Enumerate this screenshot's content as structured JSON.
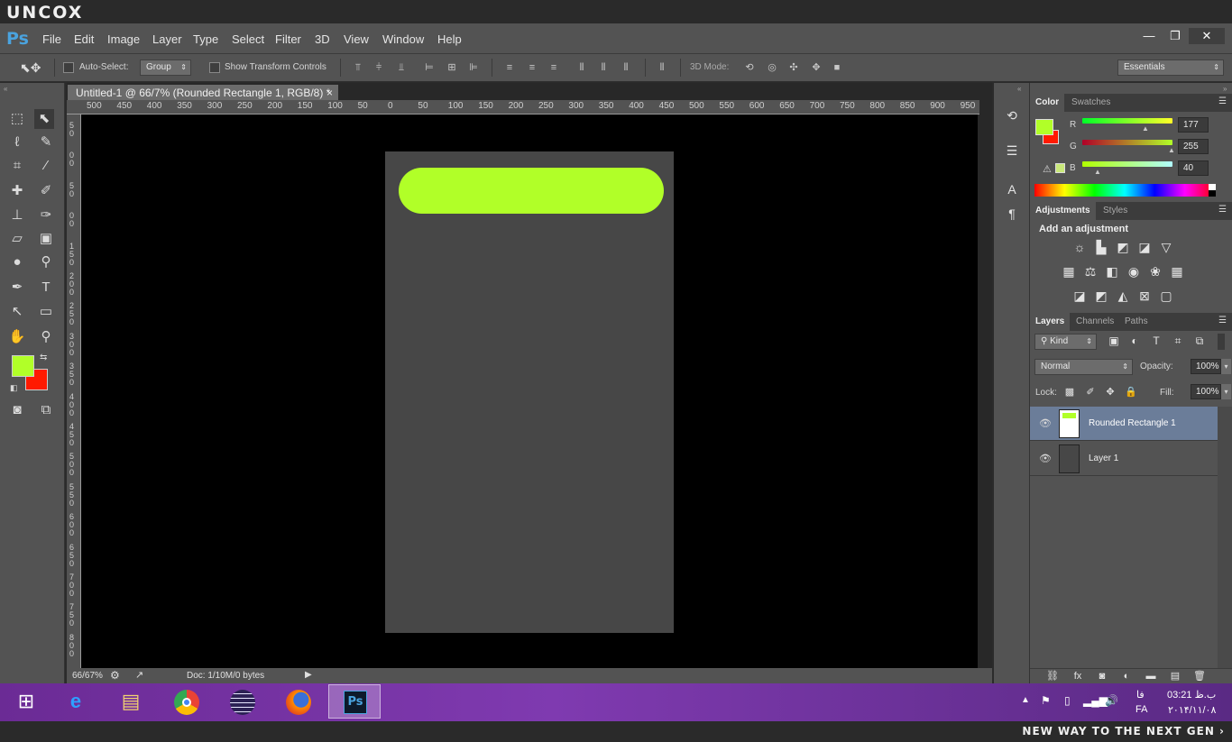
{
  "watermark_top": "UNCOX",
  "watermark_bottom": "NEW WAY TO THE NEXT GEN ›",
  "app": {
    "logo": "Ps",
    "menu": [
      "File",
      "Edit",
      "Image",
      "Layer",
      "Type",
      "Select",
      "Filter",
      "3D",
      "View",
      "Window",
      "Help"
    ]
  },
  "window_controls": {
    "minimize": "—",
    "restore": "❐",
    "close": "✕"
  },
  "options": {
    "auto_select_label": "Auto-Select:",
    "auto_select_value": "Group",
    "transform_label": "Show Transform Controls",
    "mode3d_label": "3D Mode:",
    "workspace": "Essentials"
  },
  "document": {
    "tab_title": "Untitled-1 @ 66/7% (Rounded Rectangle 1, RGB/8) *",
    "tab_close": "×",
    "zoom": "66/67%",
    "doc_info": "Doc: 1/10M/0 bytes"
  },
  "ruler": {
    "h": [
      "500",
      "450",
      "400",
      "350",
      "300",
      "250",
      "200",
      "150",
      "100",
      "50",
      "0",
      "50",
      "100",
      "150",
      "200",
      "250",
      "300",
      "350",
      "400",
      "450",
      "500",
      "550",
      "600",
      "650",
      "700",
      "750",
      "800",
      "850",
      "900",
      "950"
    ],
    "v": [
      "50",
      "00",
      "50",
      "00",
      "150",
      "200",
      "250",
      "300",
      "350",
      "400",
      "450",
      "500",
      "550",
      "600",
      "650",
      "700",
      "750",
      "800"
    ]
  },
  "colors": {
    "foreground": "#b1ff28",
    "background": "#ff1a00",
    "canvas": "#474747",
    "shape": "#b1ff28"
  },
  "color_panel": {
    "tabs": [
      "Color",
      "Swatches"
    ],
    "r_label": "R",
    "g_label": "G",
    "b_label": "B",
    "r": "177",
    "g": "255",
    "b": "40"
  },
  "adjustments": {
    "tabs": [
      "Adjustments",
      "Styles"
    ],
    "heading": "Add an adjustment",
    "icons": [
      "brightness-icon",
      "levels-icon",
      "curves-icon",
      "exposure-icon",
      "vibrance-icon",
      "hue-saturation-icon",
      "color-balance-icon",
      "black-white-icon",
      "photo-filter-icon",
      "channel-mixer-icon",
      "color-lookup-icon",
      "invert-icon",
      "posterize-icon",
      "threshold-icon",
      "gradient-map-icon",
      "selective-color-icon"
    ]
  },
  "layers": {
    "tabs": [
      "Layers",
      "Channels",
      "Paths"
    ],
    "filter": "Kind",
    "blend": "Normal",
    "opacity_label": "Opacity:",
    "opacity": "100%",
    "lock_label": "Lock:",
    "fill_label": "Fill:",
    "fill": "100%",
    "items": [
      {
        "name": "Rounded Rectangle 1",
        "selected": true
      },
      {
        "name": "Layer 1",
        "selected": false
      }
    ]
  },
  "taskbar": {
    "apps": [
      "windows-start-icon",
      "internet-explorer-icon",
      "file-explorer-icon",
      "chrome-icon",
      "eclipse-icon",
      "firefox-icon",
      "photoshop-icon"
    ],
    "time": "03:21 ب.ظ",
    "date": "۲۰۱۴/۱۱/۰۸",
    "lang_top": "فا",
    "lang": "FA"
  }
}
